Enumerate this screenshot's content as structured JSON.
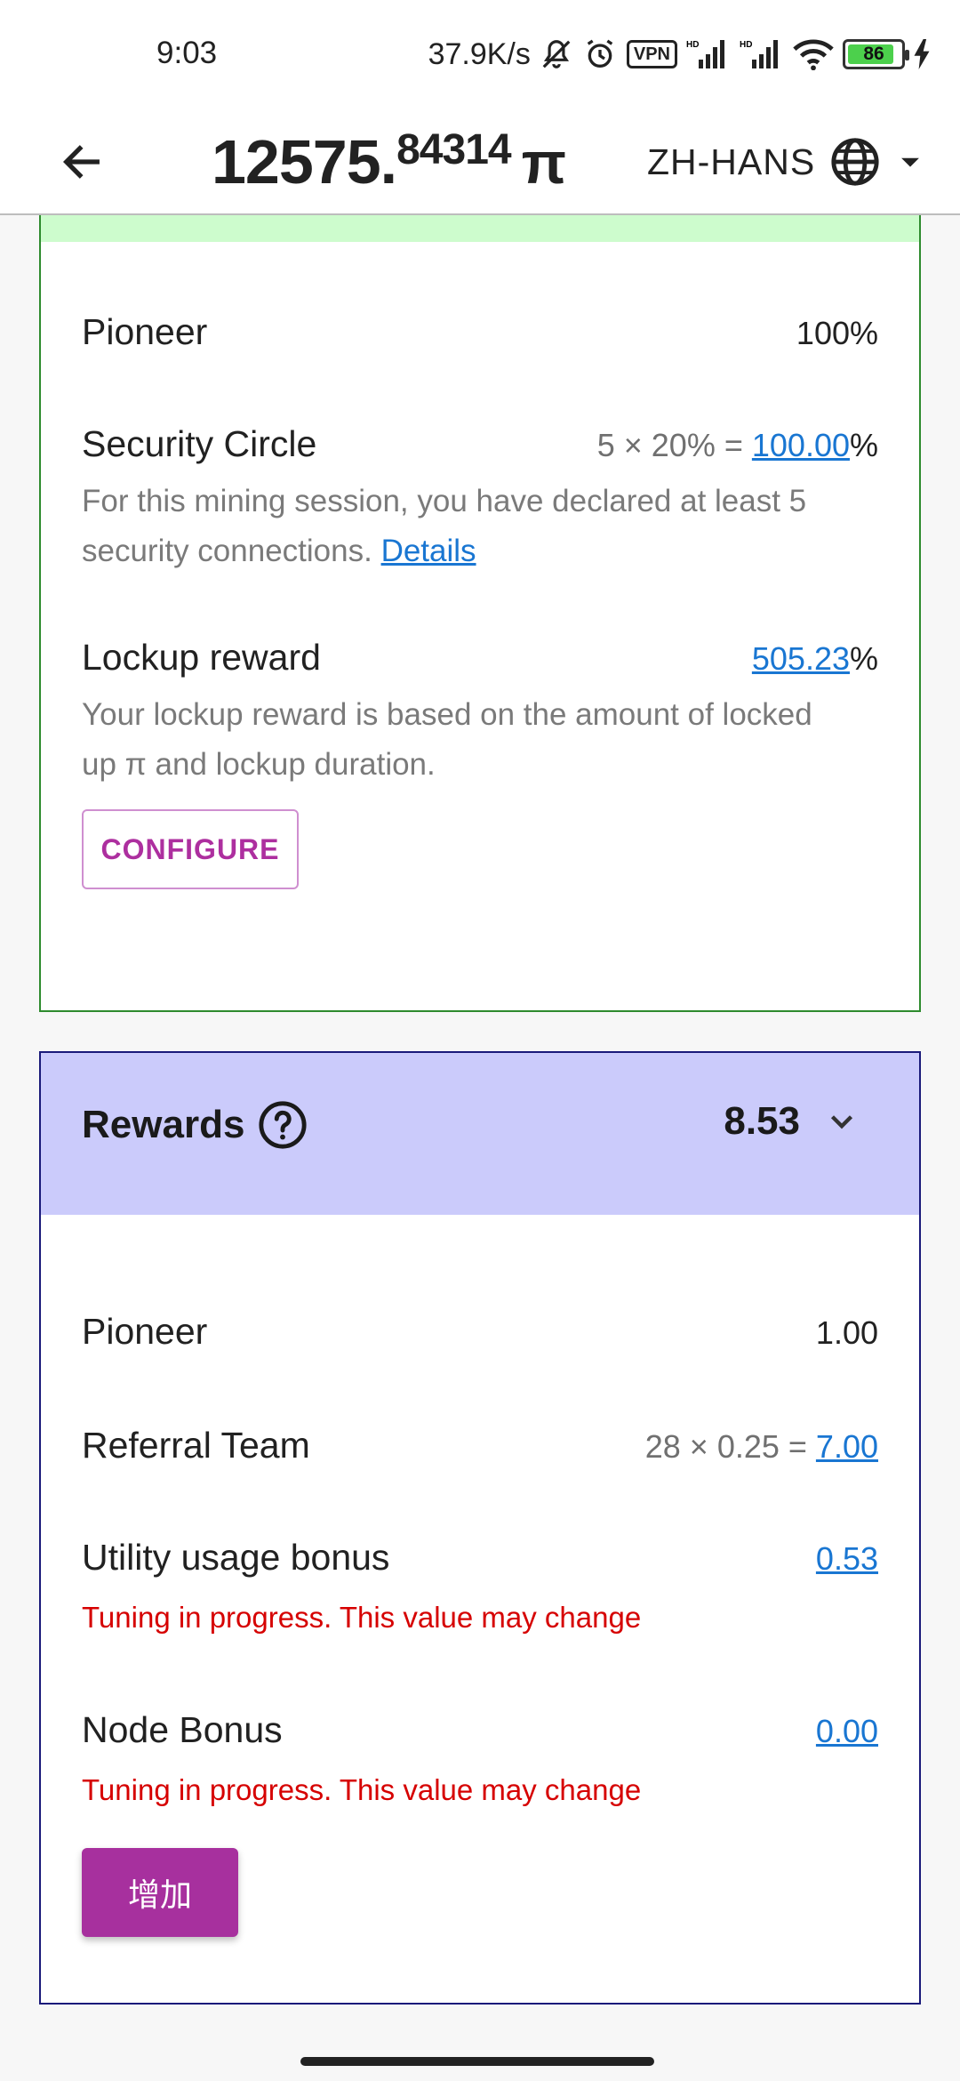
{
  "status_bar": {
    "time": "9:03",
    "net_speed": "37.9K/s",
    "vpn": "VPN",
    "battery": "86"
  },
  "header": {
    "balance_int": "12575.",
    "balance_dec": "84314",
    "currency": "π",
    "language": "ZH-HANS"
  },
  "mining_rate": {
    "pioneer": {
      "label": "Pioneer",
      "value": "100%"
    },
    "security_circle": {
      "label": "Security Circle",
      "formula": "5 × 20% = ",
      "value": "100.00",
      "suffix": "%",
      "desc": "For this mining session, you have declared at least 5 security connections.",
      "details_link": "Details"
    },
    "lockup": {
      "label": "Lockup reward",
      "value": "505.23",
      "suffix": "%",
      "desc": "Your lockup reward is based on the amount of locked up π and lockup duration.",
      "configure_label": "CONFIGURE"
    }
  },
  "rewards": {
    "title": "Rewards",
    "total": "8.53",
    "pioneer": {
      "label": "Pioneer",
      "value": "1.00"
    },
    "referral": {
      "label": "Referral Team",
      "formula": "28 × 0.25 = ",
      "value": "7.00"
    },
    "utility": {
      "label": "Utility usage bonus",
      "value": "0.53",
      "warning": "Tuning in progress. This value may change"
    },
    "node": {
      "label": "Node Bonus",
      "value": "0.00",
      "warning": "Tuning in progress. This value may change"
    },
    "add_label": "增加"
  },
  "colors": {
    "green_border": "#2e8b2e",
    "green_strip": "#cdfccd",
    "blue_header": "#cbcbfb",
    "link": "#1976d2",
    "warning": "#d60000",
    "accent": "#a7309e"
  }
}
